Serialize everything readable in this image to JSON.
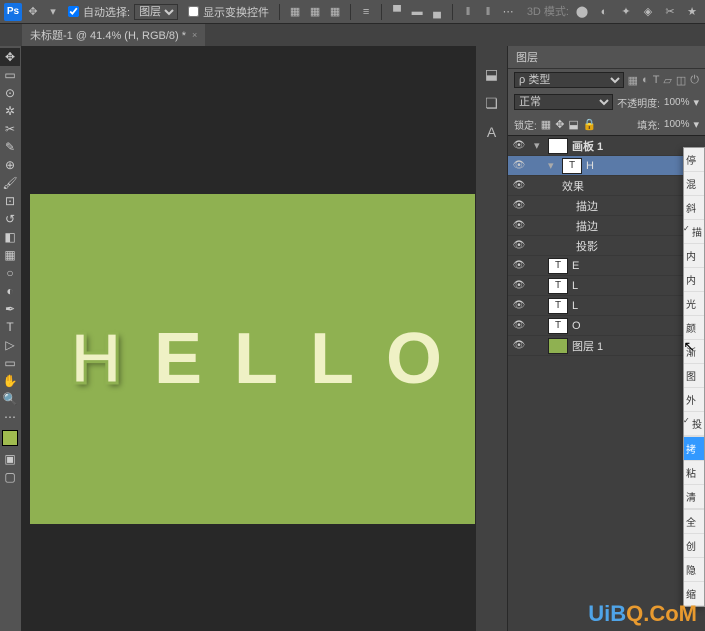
{
  "menubar": {
    "autoSelect": "自动选择:",
    "autoSelectTarget": "图层",
    "showTransform": "显示变换控件",
    "mode3d": "3D 模式:"
  },
  "tab": {
    "title": "未标题-1 @ 41.4% (H, RGB/8) *"
  },
  "panels": {
    "layersTitle": "图层",
    "filterLabel": "ρ 类型",
    "blendMode": "正常",
    "opacityLabel": "不透明度:",
    "opacityValue": "100%",
    "lockLabel": "锁定:",
    "fillLabel": "填充:",
    "fillValue": "100%"
  },
  "layers": [
    {
      "eye": true,
      "indent": 0,
      "tw": "▾",
      "thumb": "",
      "name": "画板 1",
      "bold": true
    },
    {
      "eye": true,
      "indent": 1,
      "tw": "▾",
      "thumb": "T",
      "name": "H",
      "sel": true,
      "fx": "fx"
    },
    {
      "eye": true,
      "indent": 2,
      "name": "效果",
      "sub": true
    },
    {
      "eye": true,
      "indent": 3,
      "name": "描边",
      "sub": true
    },
    {
      "eye": true,
      "indent": 3,
      "name": "描边",
      "sub": true
    },
    {
      "eye": true,
      "indent": 3,
      "name": "投影",
      "sub": true
    },
    {
      "eye": true,
      "indent": 1,
      "thumb": "T",
      "name": "E"
    },
    {
      "eye": true,
      "indent": 1,
      "thumb": "T",
      "name": "L"
    },
    {
      "eye": true,
      "indent": 1,
      "thumb": "T",
      "name": "L"
    },
    {
      "eye": true,
      "indent": 1,
      "thumb": "T",
      "name": "O"
    },
    {
      "eye": true,
      "indent": 1,
      "thumb": "g",
      "name": "图层 1"
    }
  ],
  "contextMenu": [
    {
      "t": "停"
    },
    {
      "t": "混"
    },
    {
      "t": "斜"
    },
    {
      "t": "描",
      "chk": true
    },
    {
      "t": "内"
    },
    {
      "t": "内"
    },
    {
      "t": "光"
    },
    {
      "t": "颜"
    },
    {
      "t": "渐"
    },
    {
      "t": "图"
    },
    {
      "t": "外"
    },
    {
      "t": "投",
      "chk": true
    },
    {
      "t": "",
      "sep": true
    },
    {
      "t": "拷",
      "hl": true
    },
    {
      "t": "粘"
    },
    {
      "t": "清"
    },
    {
      "t": "",
      "sep": true
    },
    {
      "t": "全"
    },
    {
      "t": "创"
    },
    {
      "t": "隐"
    },
    {
      "t": "缩"
    }
  ],
  "canvas": {
    "letters": [
      "H",
      "E",
      "L",
      "L",
      "O"
    ]
  },
  "watermark": {
    "text1": "UiB",
    "text2": "Q.CoM"
  }
}
